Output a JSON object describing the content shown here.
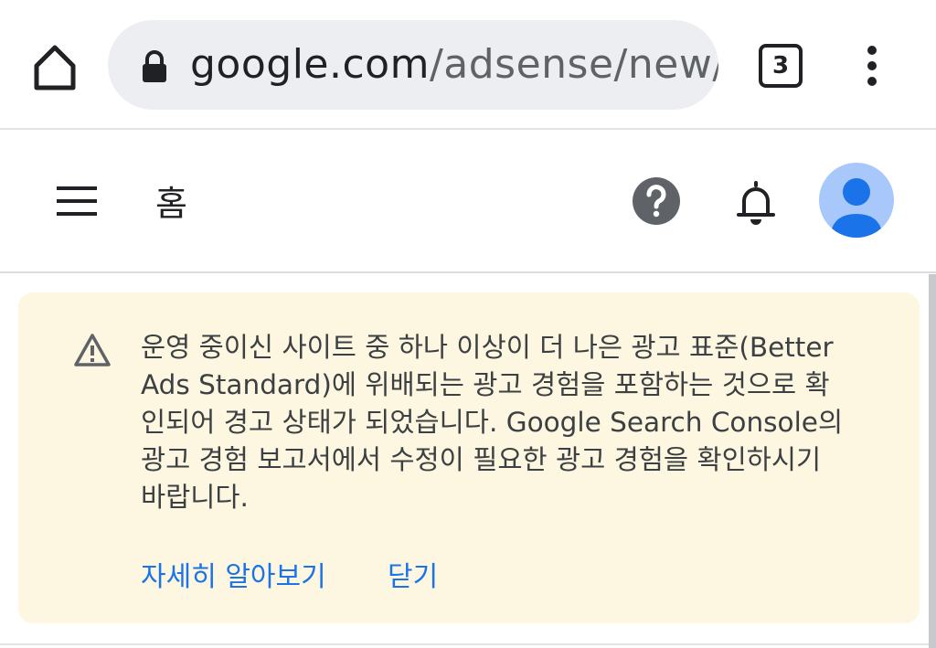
{
  "browser": {
    "url_prefix": "google.com",
    "url_suffix": "/adsense/new/u/",
    "tab_count": "3"
  },
  "appbar": {
    "title": "홈"
  },
  "warning": {
    "lines": [
      "운영 중이신 사이트 중 하나 이상이 더 나은 광고 표준(Better",
      "Ads Standard)에 위배되는 광고 경험을 포함하는 것으로 확",
      "인되어 경고 상태가 되었습니다. Google Search Console의",
      "광고 경험 보고서에서 수정이 필요한 광고 경험을 확인하시기",
      "바랍니다."
    ],
    "learn_more": "자세히 알아보기",
    "close": "닫기"
  },
  "colors": {
    "banner_bg": "#fdf6e0",
    "link": "#1a73e8",
    "avatar": "#a8c7fa",
    "avatar_figure": "#1a73e8"
  }
}
